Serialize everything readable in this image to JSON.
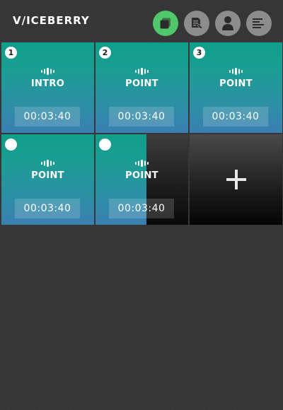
{
  "app": {
    "logo": "V/ICEBERRY"
  },
  "header": {
    "buttons": [
      {
        "name": "clips",
        "icon": "stack-icon",
        "active": true
      },
      {
        "name": "script",
        "icon": "document-edit-icon",
        "active": false
      },
      {
        "name": "profile",
        "icon": "user-icon",
        "active": false
      },
      {
        "name": "menu",
        "icon": "list-icon",
        "active": false
      }
    ]
  },
  "colors": {
    "background": "#363636",
    "accent": "#4fc76a",
    "tile_teal": "#129e89",
    "tile_blue": "#3a7fb1"
  },
  "tiles": [
    {
      "number": "1",
      "label": "INTRO",
      "time": "00:03:40",
      "state": "filled"
    },
    {
      "number": "2",
      "label": "POINT",
      "time": "00:03:40",
      "state": "filled"
    },
    {
      "number": "3",
      "label": "POINT",
      "time": "00:03:40",
      "state": "filled"
    },
    {
      "number": "",
      "label": "POINT",
      "time": "00:03:40",
      "state": "filled"
    },
    {
      "number": "",
      "label": "POINT",
      "time": "00:03:40",
      "state": "partial",
      "progress": 0.55
    },
    {
      "state": "add",
      "symbol": "+"
    }
  ]
}
